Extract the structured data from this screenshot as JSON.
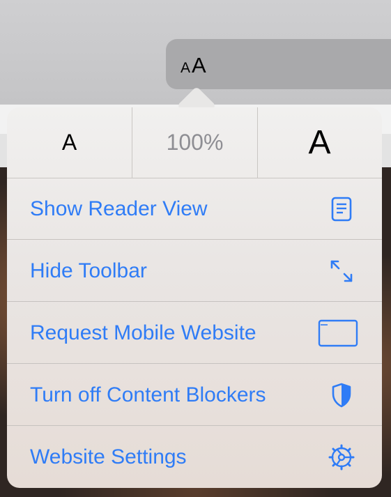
{
  "toolbar": {
    "aa_small": "A",
    "aa_large": "A"
  },
  "text_size": {
    "smaller_label": "A",
    "zoom_level": "100%",
    "larger_label": "A"
  },
  "menu": {
    "items": [
      {
        "label": "Show Reader View",
        "icon": "reader-view-icon"
      },
      {
        "label": "Hide Toolbar",
        "icon": "expand-arrows-icon"
      },
      {
        "label": "Request Mobile Website",
        "icon": "mobile-website-icon"
      },
      {
        "label": "Turn off Content Blockers",
        "icon": "shield-icon"
      },
      {
        "label": "Website Settings",
        "icon": "gear-icon"
      }
    ]
  },
  "colors": {
    "accent": "#2f7cf6",
    "popover_bg": "#ece8e6"
  }
}
